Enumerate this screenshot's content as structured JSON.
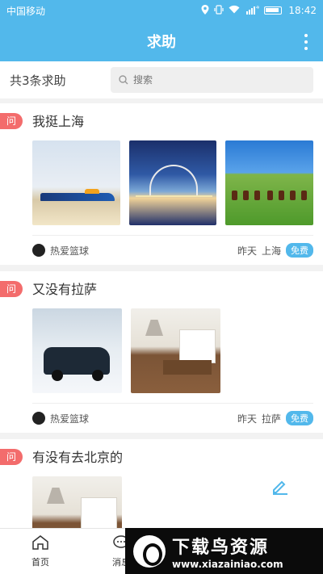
{
  "status_bar": {
    "carrier": "中国移动",
    "time": "18:42",
    "signal_badge": "4G"
  },
  "header": {
    "title": "求助"
  },
  "search_row": {
    "count_label": "共3条求助",
    "search_placeholder": "搜索"
  },
  "posts": [
    {
      "q_badge": "问",
      "title": "我挺上海",
      "images": [
        "rocket-car-photo",
        "arch-bridge-night-photo",
        "horse-race-photo"
      ],
      "user": "热爱篮球",
      "when": "昨天",
      "where": "上海",
      "tag": "免费"
    },
    {
      "q_badge": "问",
      "title": "又没有拉萨",
      "images": [
        "jeep-in-snow-photo",
        "kitchen-interior-photo"
      ],
      "user": "热爱篮球",
      "when": "昨天",
      "where": "拉萨",
      "tag": "免费"
    },
    {
      "q_badge": "问",
      "title": "有没有去北京的",
      "images": [
        "kitchen-interior-photo"
      ]
    }
  ],
  "tabbar": {
    "tabs": [
      {
        "label": "首页",
        "icon": "home-icon"
      },
      {
        "label": "消息",
        "icon": "message-icon"
      }
    ]
  },
  "watermark": {
    "brand": "下载鸟资源",
    "url": "www.xiazainiao.com"
  },
  "colors": {
    "primary": "#52b8eb",
    "question_badge": "#f36c6c"
  }
}
